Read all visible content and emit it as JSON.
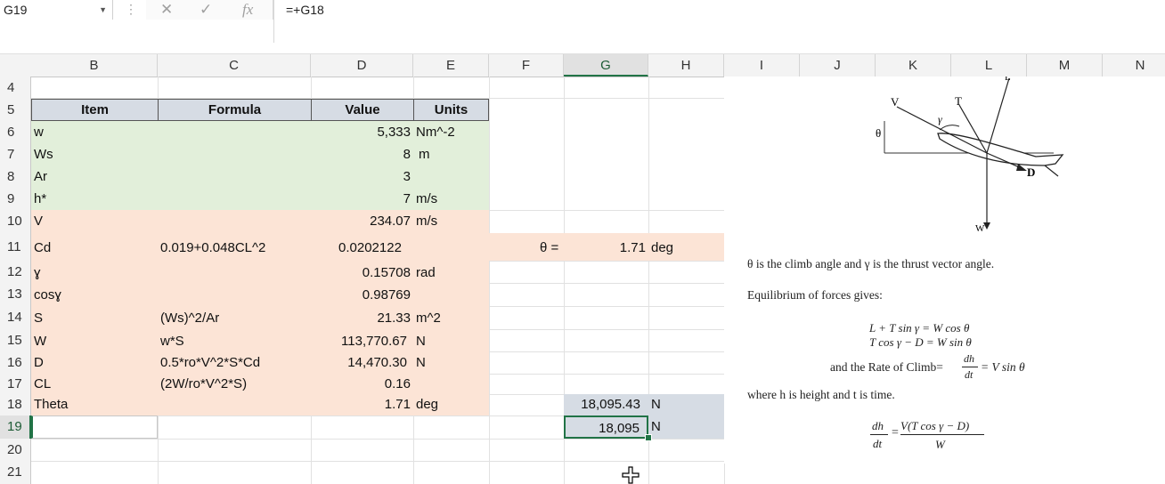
{
  "name_box": "G19",
  "formula": "=+G18",
  "toolbar": {
    "dots": "⋮",
    "cancel": "✕",
    "enter": "✓",
    "fx": "fx"
  },
  "columns": [
    "B",
    "C",
    "D",
    "E",
    "F",
    "G",
    "H",
    "I",
    "J",
    "K",
    "L",
    "M",
    "N"
  ],
  "rows": [
    "4",
    "5",
    "6",
    "7",
    "8",
    "9",
    "10",
    "11",
    "12",
    "13",
    "14",
    "15",
    "16",
    "17",
    "18",
    "19",
    "20",
    "21"
  ],
  "table_header": {
    "item": "Item",
    "formula": "Formula",
    "value": "Value",
    "units": "Units"
  },
  "table_rows": [
    {
      "item": "w",
      "formula": "",
      "value": "5,333",
      "units": "Nm^-2"
    },
    {
      "item": "Ws",
      "formula": "",
      "value": "8",
      "units": "m"
    },
    {
      "item": "Ar",
      "formula": "",
      "value": "3",
      "units": ""
    },
    {
      "item": "h*",
      "formula": "",
      "value": "7",
      "units": "m/s"
    },
    {
      "item": "V",
      "formula": "",
      "value": "234.07",
      "units": "m/s"
    },
    {
      "item": "Cd",
      "formula": "0.019+0.048CL^2",
      "value": "0.0202122",
      "units": ""
    },
    {
      "item": "ɣ",
      "formula": "",
      "value": "0.15708",
      "units": "rad"
    },
    {
      "item": "cosɣ",
      "formula": "",
      "value": "0.98769",
      "units": ""
    },
    {
      "item": "S",
      "formula": "(Ws)^2/Ar",
      "value": "21.33",
      "units": "m^2"
    },
    {
      "item": "W",
      "formula": "w*S",
      "value": "113,770.67",
      "units": "N"
    },
    {
      "item": "D",
      "formula": "0.5*ro*V^2*S*Cd",
      "value": "14,470.30",
      "units": "N"
    },
    {
      "item": "CL",
      "formula": "(2W/ro*V^2*S)",
      "value": "0.16",
      "units": ""
    },
    {
      "item": "Theta",
      "formula": "",
      "value": "1.71",
      "units": "deg"
    }
  ],
  "theta_row": {
    "label": "θ =",
    "value": "1.71",
    "units": "deg"
  },
  "g18": {
    "value": "18,095.43",
    "units": "N"
  },
  "g19": {
    "value": "18,095",
    "units": "N"
  },
  "diagram": {
    "labels": {
      "v": "V",
      "t": "T",
      "gamma": "γ",
      "theta": "θ",
      "d": "D",
      "w": "W",
      "l": "L"
    }
  },
  "notes": {
    "line1": "θ is the climb angle and γ is the thrust vector angle.",
    "line2": "Equilibrium of forces gives:",
    "eq1": "L + T sin γ = W cos θ",
    "eq2": "T cos γ − D = W sin θ",
    "eq3_pre": "and the Rate of Climb=",
    "eq3_num": "dh",
    "eq3_den": "dt",
    "eq3_post": "= V sin θ",
    "line3": "where h is height and t is time.",
    "eq4_num_l": "dh",
    "eq4_den_l": "dt",
    "eq4_num_r": "V(T cos γ − D)",
    "eq4_den_r": "W"
  }
}
